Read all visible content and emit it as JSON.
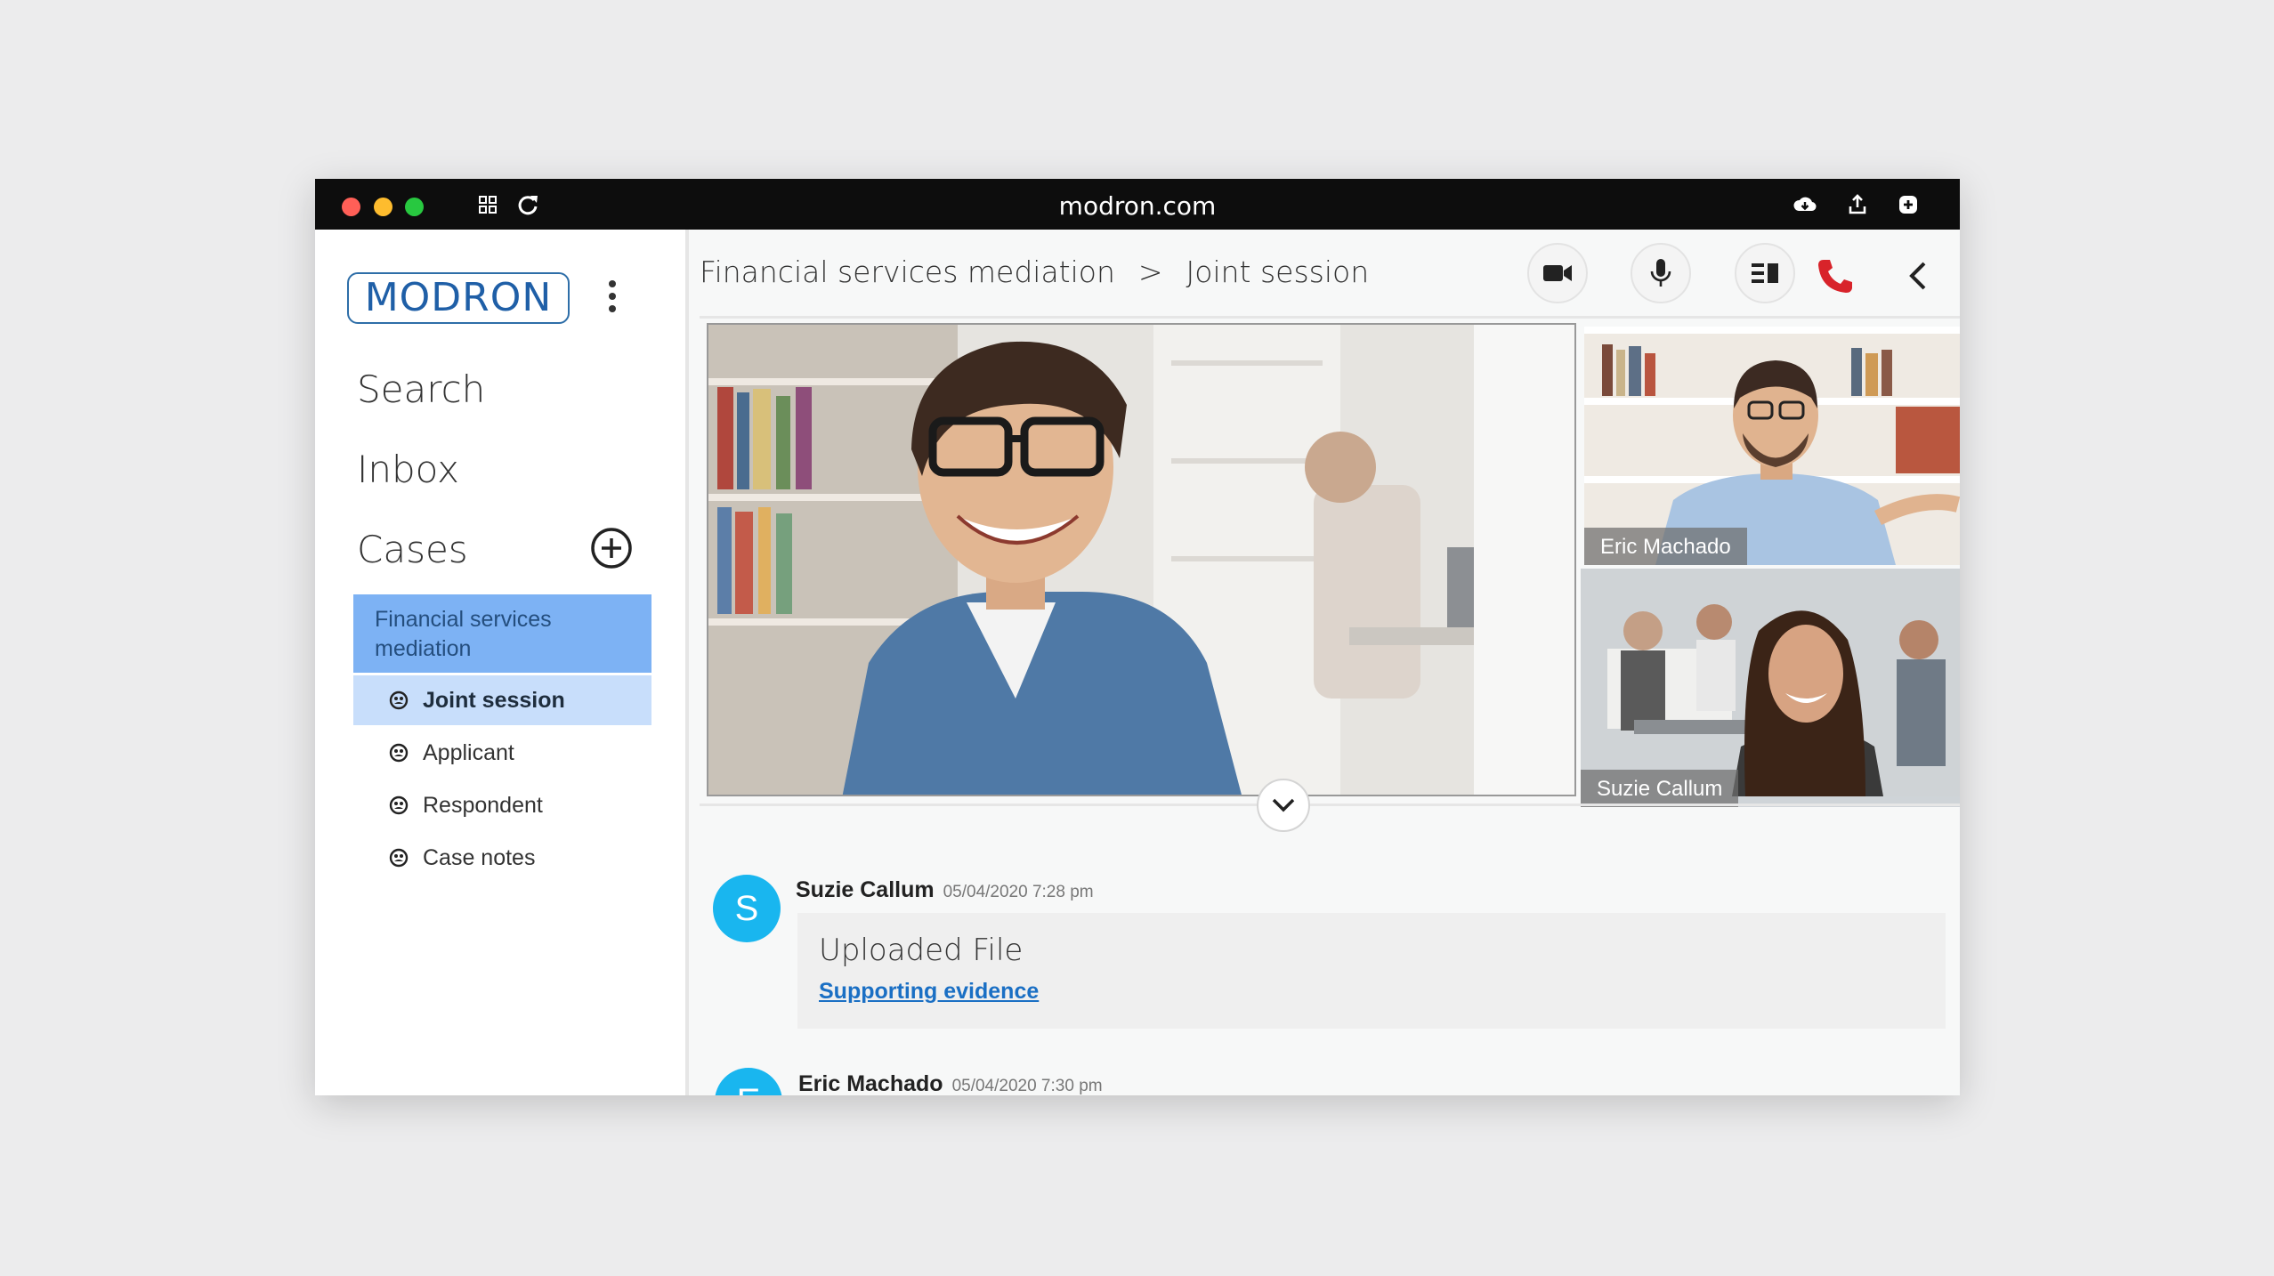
{
  "browser": {
    "url": "modron.com",
    "icons": [
      "grid-icon",
      "reload-icon",
      "cloud-download-icon",
      "share-icon",
      "new-tab-icon"
    ]
  },
  "sidebar": {
    "logo": "MODRON",
    "nav": [
      {
        "label": "Search"
      },
      {
        "label": "Inbox"
      },
      {
        "label": "Cases"
      }
    ],
    "case": {
      "label": "Financial services mediation"
    },
    "sub_items": [
      {
        "label": "Joint session",
        "active": true
      },
      {
        "label": "Applicant"
      },
      {
        "label": "Respondent"
      },
      {
        "label": "Case notes"
      }
    ]
  },
  "header": {
    "breadcrumb": [
      "Financial services mediation",
      ">",
      "Joint session"
    ],
    "controls": [
      "camera-icon",
      "microphone-icon",
      "layout-icon",
      "hang-up-icon",
      "collapse-chevron-icon"
    ]
  },
  "videos": {
    "participants": [
      {
        "name": "Eric Machado"
      },
      {
        "name": "Suzie Callum"
      }
    ]
  },
  "messages": [
    {
      "avatar": "S",
      "name": "Suzie Callum",
      "time": "05/04/2020 7:28 pm",
      "title": "Uploaded File",
      "link": "Supporting evidence"
    },
    {
      "avatar": "E",
      "name": "Eric Machado",
      "time": "05/04/2020 7:30 pm"
    }
  ],
  "colors": {
    "accent": "#7db2f4",
    "active_sub": "#c8defb",
    "avatar": "#19b6ef",
    "hangup": "#d8232a",
    "link": "#1a6fc4"
  }
}
